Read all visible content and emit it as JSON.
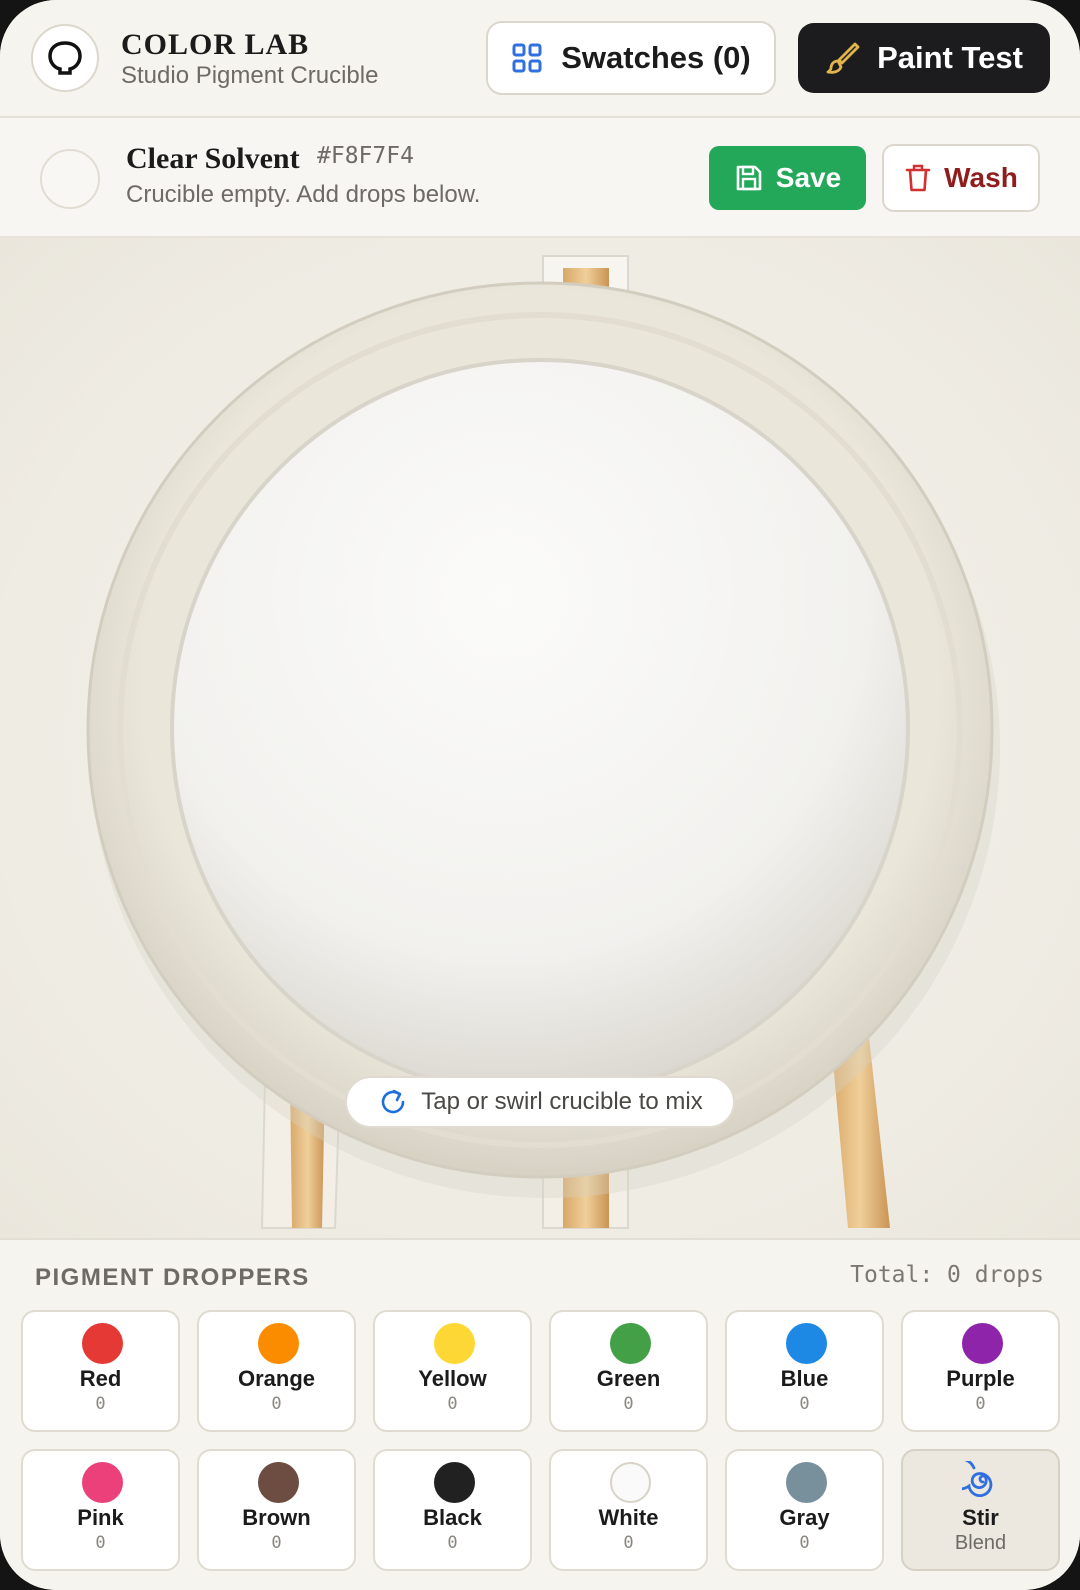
{
  "header": {
    "title": "COLOR LAB",
    "subtitle": "Studio Pigment Crucible",
    "swatches_label": "Swatches (0)",
    "paint_test_label": "Paint Test"
  },
  "current_color": {
    "name": "Clear Solvent",
    "hex": "#F8F7F4",
    "status": "Crucible empty. Add drops below.",
    "save_label": "Save",
    "wash_label": "Wash"
  },
  "crucible": {
    "hint": "Tap or swirl crucible to mix"
  },
  "droppers": {
    "title": "PIGMENT DROPPERS",
    "total": "Total: 0 drops",
    "items": [
      {
        "name": "Red",
        "count": "0",
        "color": "#e53935"
      },
      {
        "name": "Orange",
        "count": "0",
        "color": "#fb8c00"
      },
      {
        "name": "Yellow",
        "count": "0",
        "color": "#fdd835"
      },
      {
        "name": "Green",
        "count": "0",
        "color": "#43a047"
      },
      {
        "name": "Blue",
        "count": "0",
        "color": "#1e88e5"
      },
      {
        "name": "Purple",
        "count": "0",
        "color": "#8e24aa"
      },
      {
        "name": "Pink",
        "count": "0",
        "color": "#ec407a"
      },
      {
        "name": "Brown",
        "count": "0",
        "color": "#6d4c41"
      },
      {
        "name": "Black",
        "count": "0",
        "color": "#212121"
      },
      {
        "name": "White",
        "count": "0",
        "color": "#fafafa"
      },
      {
        "name": "Gray",
        "count": "0",
        "color": "#78909c"
      }
    ],
    "stir": {
      "name": "Stir",
      "sub": "Blend"
    }
  },
  "colors": {
    "accent_green": "#23a85a",
    "wash_red": "#8f1d1d",
    "dark_button": "#1c1c1e",
    "swatch_icon_blue": "#2f6fe0"
  }
}
